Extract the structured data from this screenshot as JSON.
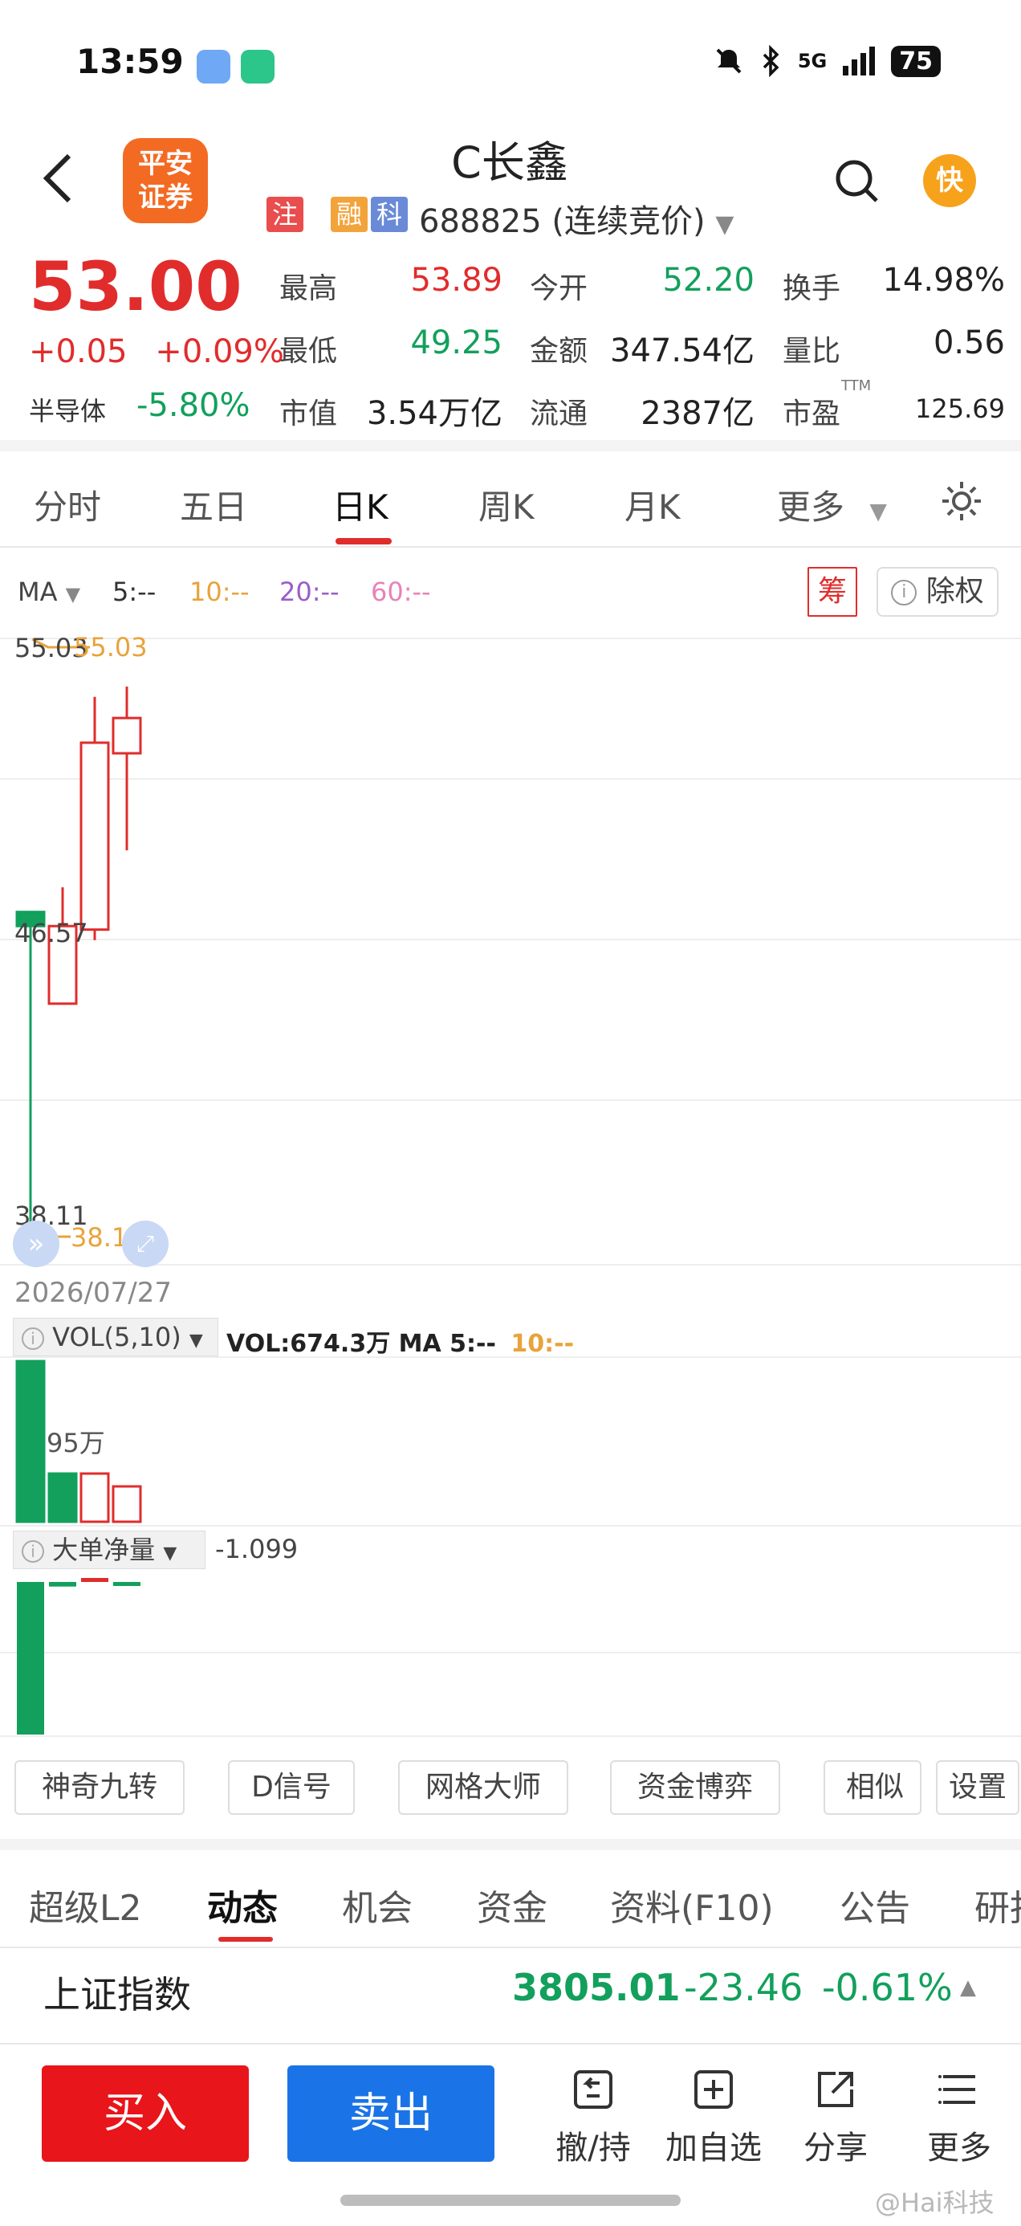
{
  "status_bar": {
    "time": "13:59",
    "network": "5G",
    "battery": "75",
    "icons": [
      "weather-icon",
      "shield-app-icon",
      "mute-icon",
      "bluetooth-icon",
      "signal-icon"
    ]
  },
  "header": {
    "back_icon": "chevron-left-icon",
    "broker_logo": "平安证券",
    "title": "C长鑫",
    "tags": [
      "注",
      "融",
      "科"
    ],
    "code": "688825",
    "status": "(连续竞价)",
    "search_icon": "search-icon",
    "kuai_label": "快"
  },
  "quote": {
    "price": "53.00",
    "change": "+0.05",
    "change_pct": "+0.09%",
    "sector_label": "半导体",
    "sector_change": "-5.80%",
    "rows": [
      [
        {
          "label": "最高",
          "value": "53.89",
          "color": "red"
        },
        {
          "label": "今开",
          "value": "52.20",
          "color": "green"
        },
        {
          "label": "换手",
          "value": "14.98%",
          "color": "black"
        }
      ],
      [
        {
          "label": "最低",
          "value": "49.25",
          "color": "green"
        },
        {
          "label": "金额",
          "value": "347.54亿",
          "color": "black"
        },
        {
          "label": "量比",
          "value": "0.56",
          "color": "black"
        }
      ],
      [
        {
          "label": "市值",
          "value": "3.54万亿",
          "color": "black"
        },
        {
          "label": "流通",
          "value": "2387亿",
          "color": "black"
        },
        {
          "label": "市盈",
          "value": "125.69",
          "color": "black"
        }
      ]
    ],
    "ttm_label": "TTM"
  },
  "period_tabs": [
    "分时",
    "五日",
    "日K",
    "周K",
    "月K",
    "更多"
  ],
  "active_period": "日K",
  "ma_row": {
    "label": "MA",
    "ma5": "5:--",
    "ma10": "10:--",
    "ma20": "20:--",
    "ma60": "60:--",
    "chip_label": "筹",
    "adjust_label": "除权"
  },
  "chart_data": {
    "type": "candlestick",
    "date": "2026/07/27",
    "y_labels": [
      "55.03",
      "46.57",
      "38.11"
    ],
    "max_label": "55.03",
    "min_label": "38.11",
    "ylim": [
      38.11,
      55.03
    ],
    "candles": [
      {
        "open": 47.1,
        "close": 47.5,
        "high": 47.5,
        "low": 38.11,
        "color": "green"
      },
      {
        "open": 44.9,
        "close": 47.1,
        "high": 48.2,
        "low": 44.9,
        "color": "red"
      },
      {
        "open": 47.0,
        "close": 52.3,
        "high": 53.6,
        "low": 46.7,
        "color": "red"
      },
      {
        "open": 52.0,
        "close": 53.0,
        "high": 53.89,
        "low": 49.25,
        "color": "red"
      }
    ],
    "volume": {
      "header": "VOL(5,10)",
      "value_text": "VOL:674.3万",
      "ma5": "MA 5:--",
      "ma10": "10:--",
      "axis_label": "95万",
      "bars": [
        {
          "value": 1.0,
          "color": "green",
          "filled": true
        },
        {
          "value": 0.3,
          "color": "green",
          "filled": true
        },
        {
          "value": 0.3,
          "color": "red",
          "filled": false
        },
        {
          "value": 0.22,
          "color": "red",
          "filled": false
        }
      ]
    },
    "net_flow": {
      "header": "大单净量",
      "value": "-1.099",
      "bars": [
        {
          "value": -1.0,
          "color": "green"
        },
        {
          "value": -0.03,
          "color": "green"
        },
        {
          "value": 0.02,
          "color": "red"
        },
        {
          "value": -0.025,
          "color": "green"
        }
      ]
    }
  },
  "tools": [
    "神奇九转",
    "D信号",
    "网格大师",
    "资金博弈",
    "相似K",
    "设置"
  ],
  "bottom_tabs": [
    "超级L2",
    "动态",
    "机会",
    "资金",
    "资料(F10)",
    "公告",
    "研报"
  ],
  "active_bottom_tab": "动态",
  "index_bar": {
    "name": "上证指数",
    "value": "3805.01",
    "change": "-23.46",
    "change_pct": "-0.61%"
  },
  "actions": {
    "buy": "买入",
    "sell": "卖出",
    "items": [
      {
        "label": "撤/持",
        "icon": "undo-icon"
      },
      {
        "label": "加自选",
        "icon": "add-watchlist-icon"
      },
      {
        "label": "分享",
        "icon": "share-icon"
      },
      {
        "label": "更多",
        "icon": "menu-icon"
      }
    ]
  },
  "watermark": "@Hai科技",
  "colors": {
    "red": "#e12c2c",
    "green": "#12a05c",
    "buy": "#e8151b",
    "sell": "#1a74e8",
    "brand": "#f36a23"
  }
}
